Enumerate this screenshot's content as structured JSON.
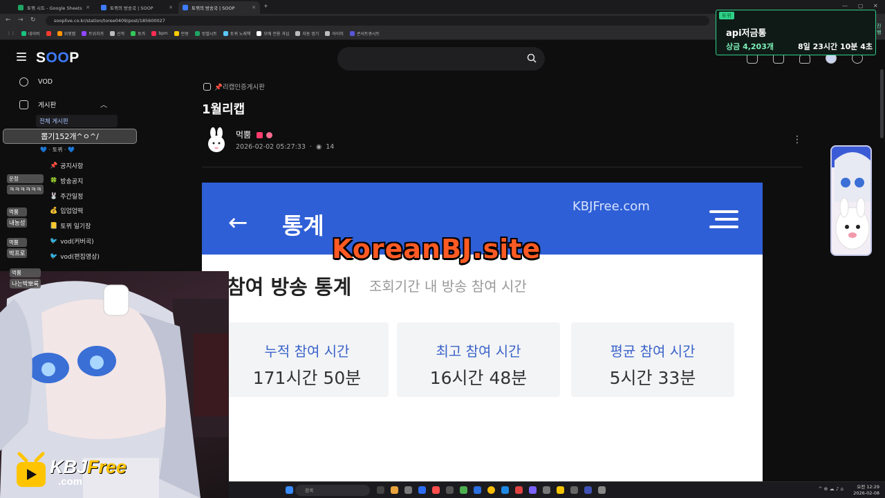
{
  "browser": {
    "tabs": [
      {
        "label": "토뀌 시트 - Google Sheets",
        "fav_color": "#1fa463"
      },
      {
        "label": "토뀌의 방송국 | SOOP",
        "fav_color": "#3e7bff"
      },
      {
        "label": "토뀌의 방송국 | SOOP",
        "fav_color": "#3e7bff"
      }
    ],
    "new_tab": "+",
    "url": "sooplive.co.kr/station/toree0409/post/185600027",
    "bookmarks": [
      {
        "label": "네이버",
        "color": "#19c37d"
      },
      {
        "label": "",
        "color": "#ff3b30"
      },
      {
        "label": "위젯맵",
        "color": "#ff9500"
      },
      {
        "label": "트위치카",
        "color": "#9146ff"
      },
      {
        "label": "신작",
        "color": "#bbbbbb"
      },
      {
        "label": "토카",
        "color": "#34c759"
      },
      {
        "label": "bpm",
        "color": "#ff2d55"
      },
      {
        "label": "만왕",
        "color": "#ffcc00"
      },
      {
        "label": "방셀시트",
        "color": "#1fa463"
      },
      {
        "label": "토뀌 노래책",
        "color": "#5ac8fa"
      },
      {
        "label": "모에 전용 과심",
        "color": "#ffffff"
      },
      {
        "label": "자동 멍기",
        "color": "#bbbbbb"
      },
      {
        "label": "아이미",
        "color": "#bbbbbb"
      },
      {
        "label": "콘서트큐시트",
        "color": "#5856d6"
      }
    ]
  },
  "header": {
    "logo_a": "S",
    "logo_b": "OO",
    "logo_c": "P"
  },
  "sidebar": {
    "vod": "VOD",
    "board": "게시판",
    "all_posts": "전체 게시판",
    "sep": "💙 · 토뀌 · 💙",
    "items": [
      {
        "icon": "📌",
        "label": "공지사항"
      },
      {
        "icon": "🍀",
        "label": "방송공지"
      },
      {
        "icon": "🐰",
        "label": "주간일정"
      },
      {
        "icon": "💰",
        "label": "입업업떡"
      },
      {
        "icon": "📒",
        "label": "토뀌 일기장"
      },
      {
        "icon": "🐦",
        "label": "vod(커버곡)"
      },
      {
        "icon": "🐦",
        "label": "vod(편집영상)"
      }
    ]
  },
  "chat": {
    "main": "뽑기152개^ㅇ^/",
    "rows": [
      {
        "nick": "운정",
        "msg": "ㅋㅋㅋㅋㅋㅋ"
      },
      {
        "nick": "먹뿜",
        "msg": "내농성"
      },
      {
        "nick": "먹뿜",
        "msg": "박프로"
      },
      {
        "nick": "먹뿜",
        "msg": "나는박뽀룩"
      }
    ]
  },
  "post": {
    "crumb": "📌리캡인증게시판",
    "title": "1월리캡",
    "author": "먹뿜",
    "date": "2026-02-02 05:27:33",
    "views": "14"
  },
  "screenshot": {
    "back": "←",
    "title": "통계",
    "site": "KBJFree.com",
    "heading": "참여 방송 통계",
    "heading_sub": "조회기간 내 방송 참여 시간",
    "stats": [
      {
        "label": "누적 참여 시간",
        "value": "171시간 50분"
      },
      {
        "label": "최고 참여 시간",
        "value": "16시간 48분"
      },
      {
        "label": "평균 참여 시간",
        "value": "5시간 33분"
      }
    ]
  },
  "watermark": "KoreanBJ.site",
  "kbj": {
    "a": "KBJ",
    "b": "Free",
    "c": ".com"
  },
  "widget": {
    "tag": "토뀌",
    "title": "api저금통",
    "left": "상금 4,203개",
    "right": "8일 23시간 10분   4초",
    "side": "진행"
  },
  "taskbar": {
    "search": "검색",
    "tray": "^  ⊕  ☁  ♪  ⌂",
    "time": "오전 12:29",
    "date": "2026-02-08"
  }
}
